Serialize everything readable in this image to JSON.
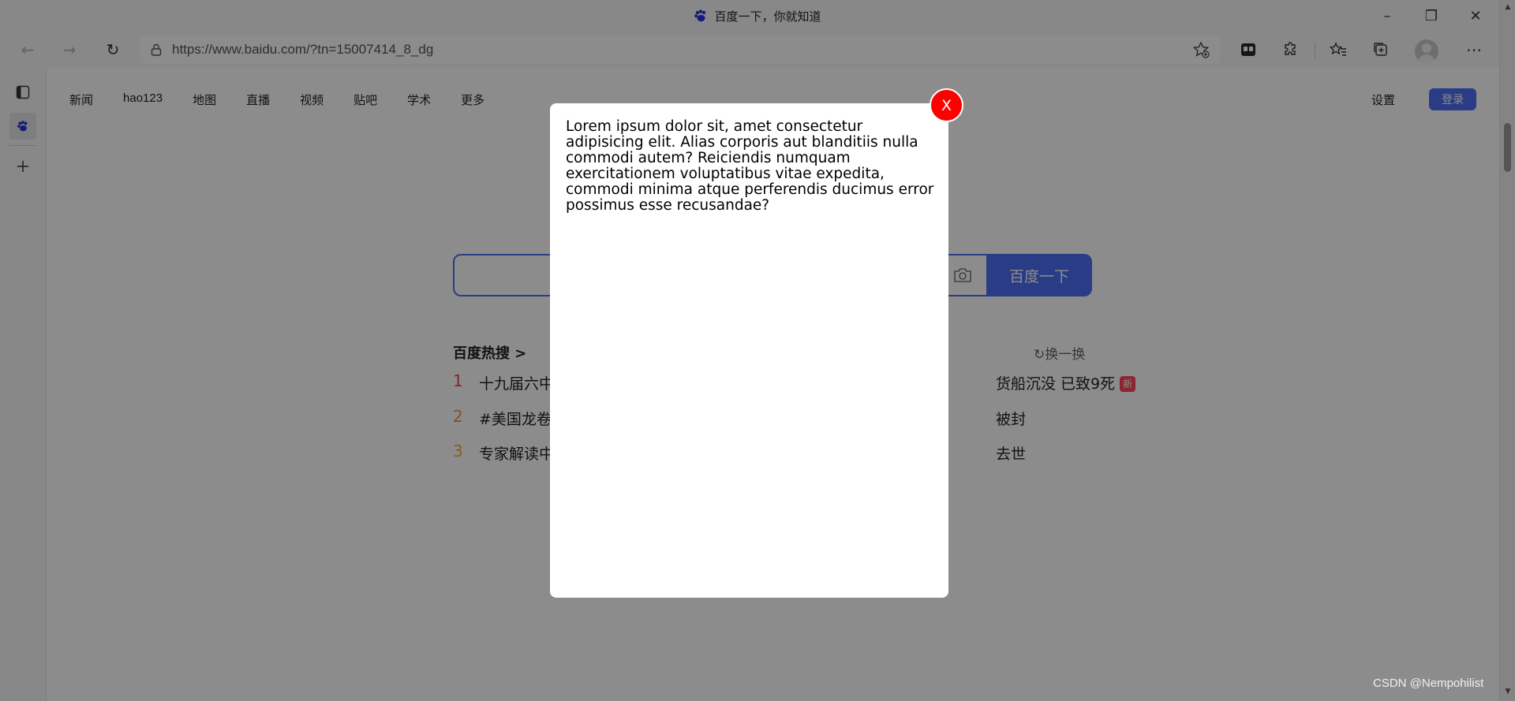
{
  "window": {
    "title": "百度一下，你就知道",
    "minimize": "–",
    "restore": "❐",
    "close": "✕"
  },
  "toolbar": {
    "back": "←",
    "forward": "→",
    "reload": "↻",
    "url": "https://www.baidu.com/?tn=15007414_8_dg",
    "more": "⋯"
  },
  "baidu": {
    "nav": [
      "新闻",
      "hao123",
      "地图",
      "直播",
      "视频",
      "贴吧",
      "学术",
      "更多"
    ],
    "settings": "设置",
    "login": "登录",
    "search_button": "百度一下",
    "hot_title": "百度热搜 >",
    "refresh": "换一换",
    "hot_items": [
      {
        "num": "1",
        "left": "十九届六中",
        "right": "货船沉没 已致9死",
        "badge": "新"
      },
      {
        "num": "2",
        "left": "#美国龙卷",
        "right": "被封"
      },
      {
        "num": "3",
        "left": "专家解读中",
        "right": "去世"
      }
    ]
  },
  "modal": {
    "text": "Lorem ipsum dolor sit, amet consectetur adipisicing elit. Alias corporis aut blanditiis nulla commodi autem? Reiciendis numquam exercitationem voluptatibus vitae expedita, commodi minima atque perferendis ducimus error possimus esse recusandae?",
    "close_label": "X"
  },
  "watermark": "CSDN @Nempohilist",
  "colors": {
    "accent": "#4e6ef2",
    "close": "#ff0000",
    "hot1": "#f54545",
    "hot2": "#ff8547",
    "hot3": "#ffac38"
  }
}
